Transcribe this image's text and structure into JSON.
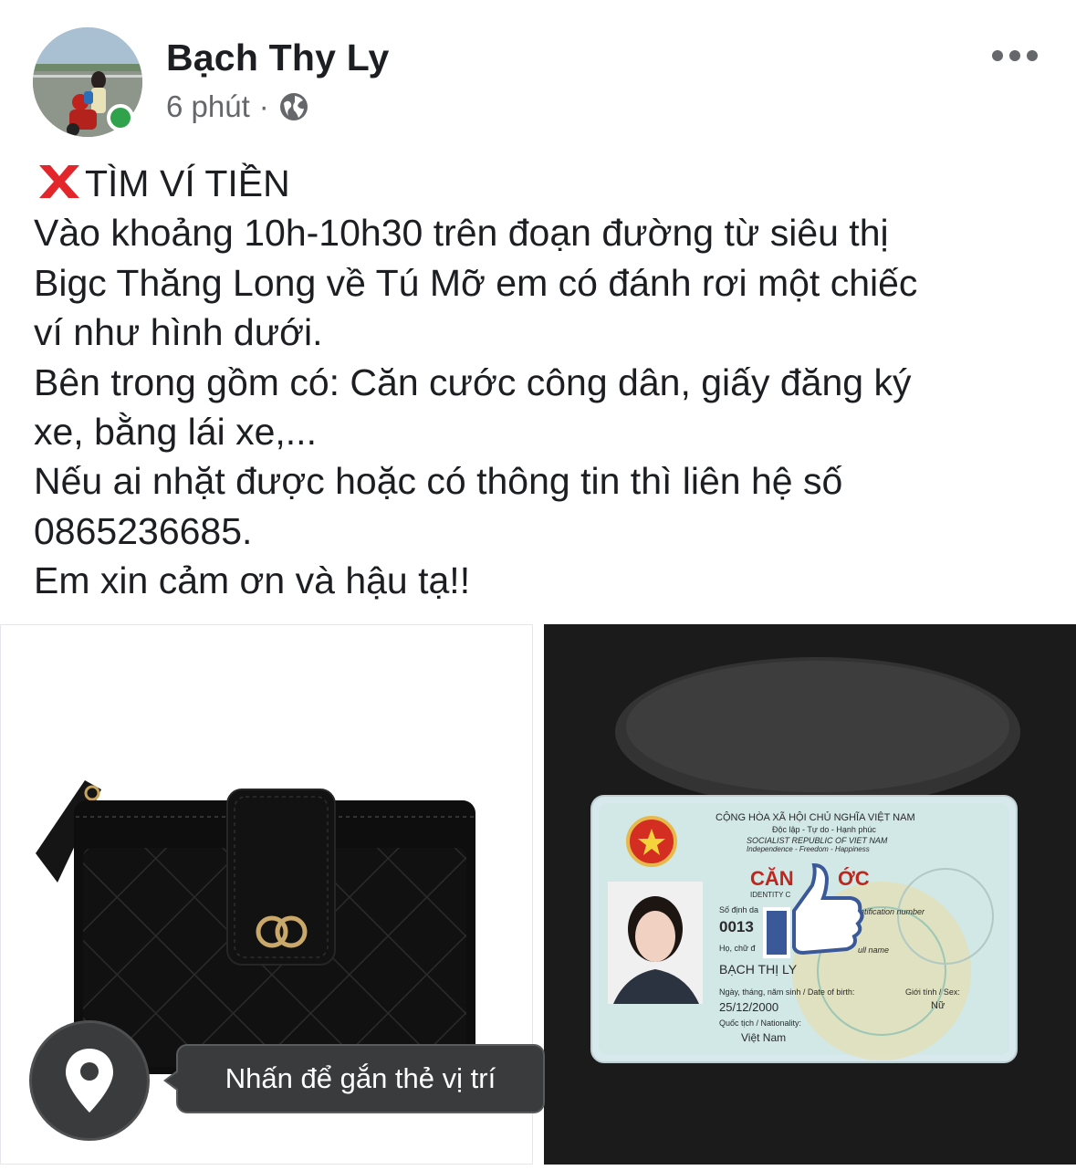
{
  "post": {
    "author": "Bạch Thy Ly",
    "time": "6 phút",
    "separator": "·",
    "privacy_icon": "globe-icon",
    "title": "TÌM VÍ TIỀN",
    "lines": [
      "Vào khoảng 10h-10h30 trên đoạn đường từ siêu thị",
      "Bigc Thăng Long về Tú Mỡ em có đánh rơi một chiếc",
      "ví như hình dưới.",
      "Bên trong gồm có: Căn cước công dân, giấy đăng ký",
      "xe, bằng lái xe,...",
      "Nếu ai nhặt được hoặc có thông tin thì liên hệ số",
      "0865236685.",
      "Em xin cảm ơn và hậu tạ!!"
    ]
  },
  "photos": {
    "location_tip": "Nhấn để gắn thẻ vị trí"
  },
  "id_card": {
    "header1": "CỘNG HÒA XÃ HỘI CHỦ NGHĨA VIỆT NAM",
    "header2": "Độc lập - Tự do - Hạnh phúc",
    "header3": "SOCIALIST REPUBLIC OF VIET NAM",
    "header4": "Independence - Freedom - Happiness",
    "title_visible": "CĂN",
    "title_tail": "ỚC",
    "subtitle": "IDENTITY C",
    "id_label": "Số định da",
    "id_label_en": "ntification number",
    "id_number": "0013",
    "name_label": "Họ, chữ đ",
    "name_label_en": "ull name",
    "name": "BẠCH THỊ LY",
    "dob_label": "Ngày, tháng, năm sinh / Date of birth:",
    "dob": "25/12/2000",
    "sex_label": "Giới tính / Sex:",
    "sex": "Nữ",
    "nat_label": "Quốc tịch / Nationality:",
    "nationality": "Việt Nam"
  },
  "colors": {
    "online": "#31a24c",
    "text": "#1c1e21",
    "muted": "#65676b",
    "cross": "#e3262b",
    "like_blue": "#3b5998"
  }
}
